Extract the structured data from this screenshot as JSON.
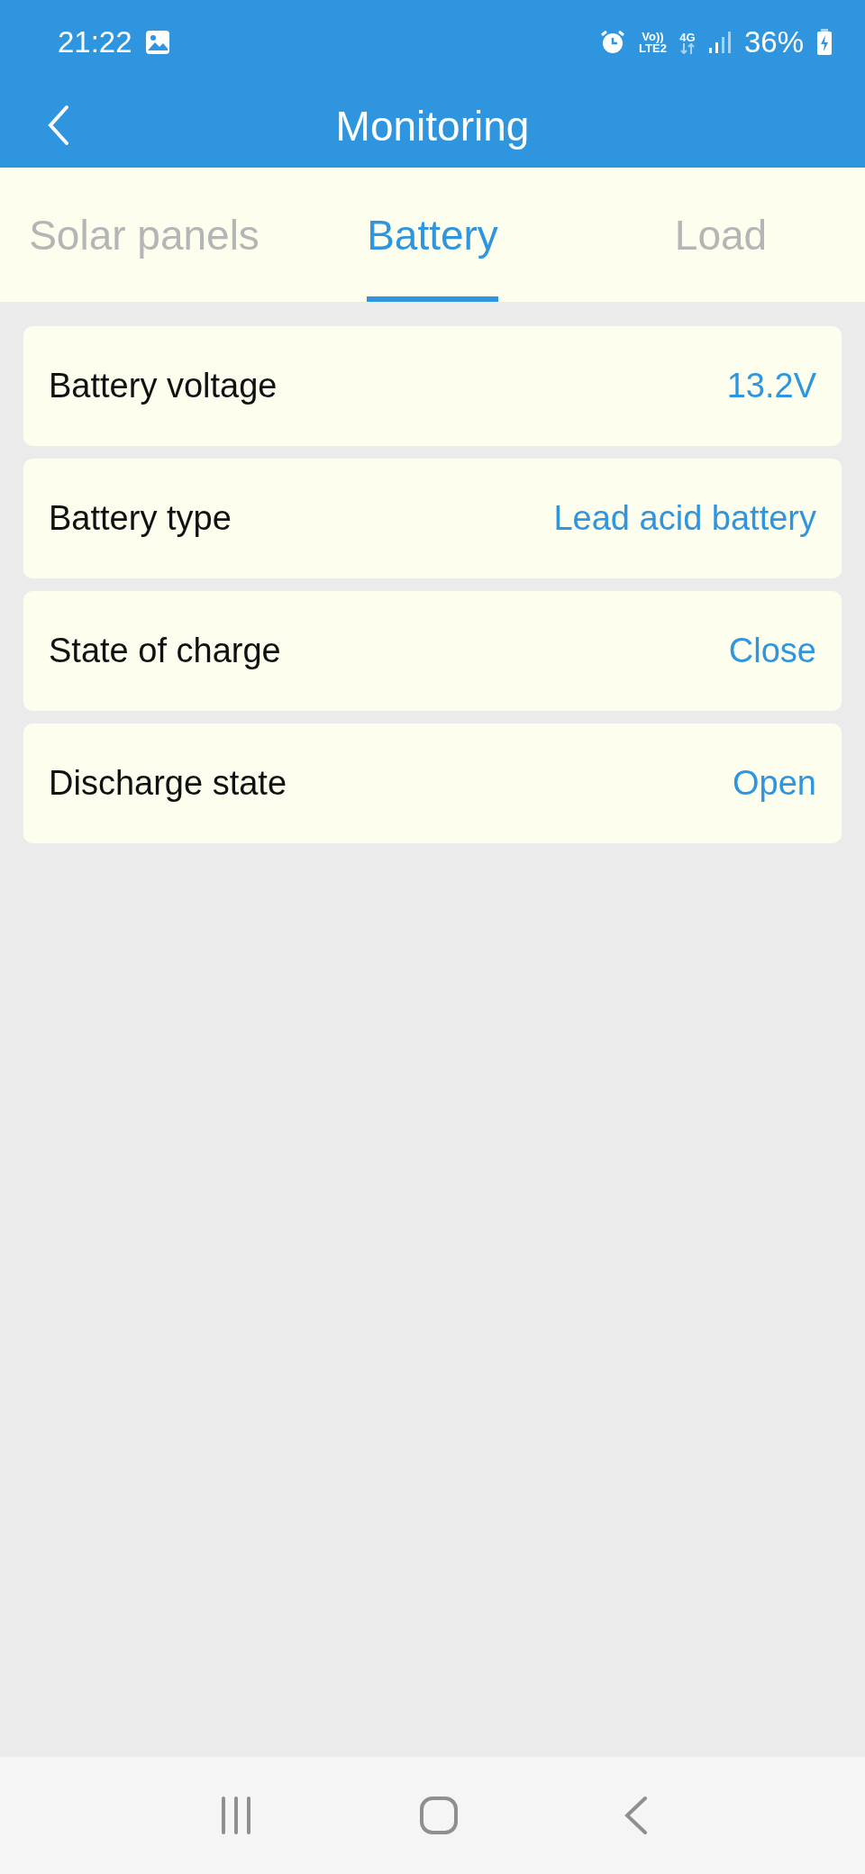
{
  "status_bar": {
    "time": "21:22",
    "volte_top": "Vo))",
    "volte_bottom": "LTE2",
    "network": "4G",
    "battery": "36%"
  },
  "toolbar": {
    "title": "Monitoring"
  },
  "tabs": [
    {
      "label": "Solar panels",
      "selected": false
    },
    {
      "label": "Battery",
      "selected": true
    },
    {
      "label": "Load",
      "selected": false
    }
  ],
  "rows": [
    {
      "label": "Battery voltage",
      "value": "13.2V"
    },
    {
      "label": "Battery type",
      "value": "Lead acid battery"
    },
    {
      "label": "State of charge",
      "value": "Close"
    },
    {
      "label": "Discharge state",
      "value": "Open"
    }
  ]
}
